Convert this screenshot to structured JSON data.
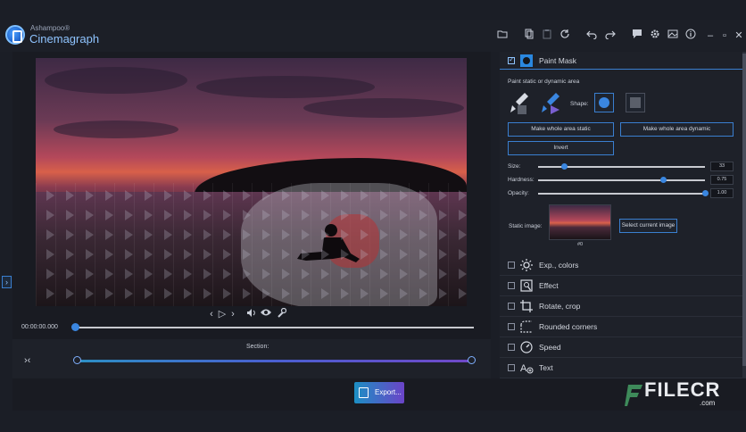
{
  "app": {
    "brand_small": "Ashampoo®",
    "brand_big": "Cinemagraph"
  },
  "toolbar": {
    "icons": [
      "folder-icon",
      "copy-icon",
      "paste-icon",
      "refresh-icon",
      "undo-icon",
      "redo-icon",
      "feedback-icon",
      "settings-icon",
      "image-icon",
      "info-icon"
    ],
    "window_controls": [
      "minimize",
      "maximize",
      "close"
    ]
  },
  "player": {
    "time": "00:00:00.000",
    "position_fraction": 0.0
  },
  "section": {
    "label": "Section:",
    "start_fraction": 0.0,
    "end_fraction": 1.0
  },
  "export": {
    "label": "Export..."
  },
  "watermark": {
    "text": "FILECR",
    "domain": ".com"
  },
  "panel": {
    "paint_mask": {
      "title": "Paint Mask",
      "checked": true,
      "hint": "Paint static or dynamic area",
      "shape_label": "Shape:",
      "static_btn": "Make whole area static",
      "dynamic_btn": "Make whole area dynamic",
      "invert_btn": "Invert",
      "size_label": "Size:",
      "size_value": "33",
      "size_fraction": 0.16,
      "hardness_label": "Hardness:",
      "hardness_value": "0.75",
      "hardness_fraction": 0.75,
      "opacity_label": "Opacity:",
      "opacity_value": "1.00",
      "opacity_fraction": 1.0,
      "static_image_label": "Static image:",
      "frame_label": "#0",
      "select_current_btn": "Select current image"
    },
    "sections": [
      {
        "title": "Exp., colors",
        "icon": "sun-icon"
      },
      {
        "title": "Effect",
        "icon": "effect-icon"
      },
      {
        "title": "Rotate, crop",
        "icon": "crop-icon"
      },
      {
        "title": "Rounded corners",
        "icon": "rounded-corners-icon"
      },
      {
        "title": "Speed",
        "icon": "speed-icon"
      },
      {
        "title": "Text",
        "icon": "text-icon"
      }
    ]
  },
  "colors": {
    "accent": "#3a86e0",
    "accent_border": "#3a7fd0",
    "background": "#1b1e26"
  }
}
